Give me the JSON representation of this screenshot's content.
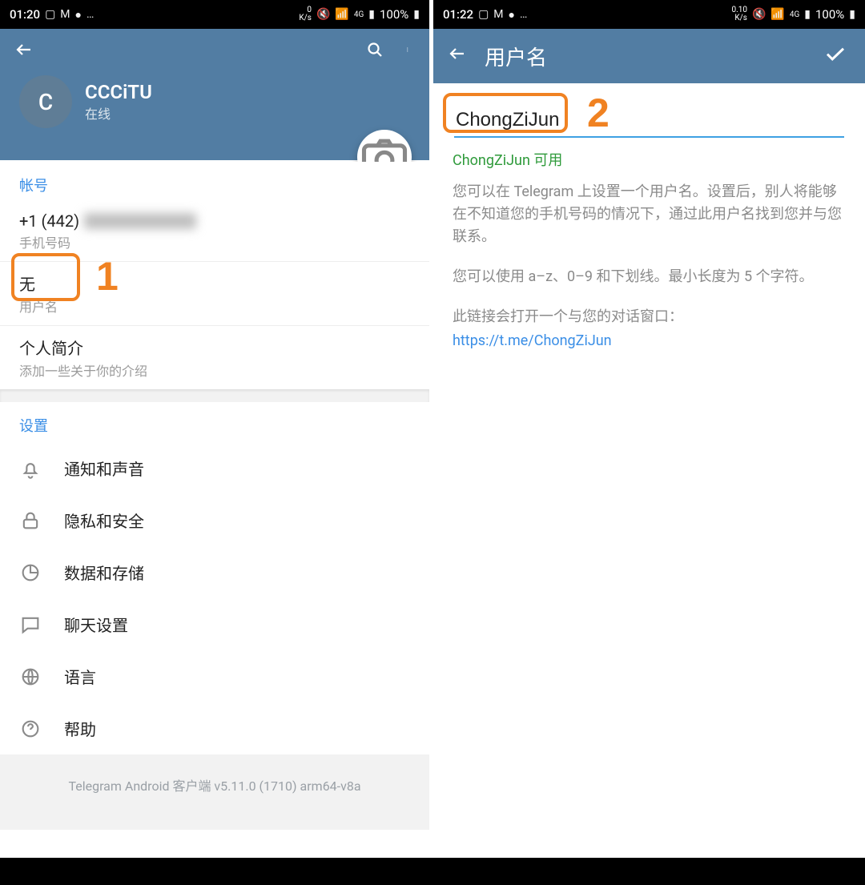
{
  "left": {
    "statusbar": {
      "time": "01:20",
      "kbs": "0\nK/s",
      "battery": "100%"
    },
    "profile": {
      "avatar_letter": "C",
      "name": "CCCiTU",
      "status": "在线"
    },
    "account_header": "帐号",
    "phone": {
      "value": "+1 (442)",
      "label": "手机号码"
    },
    "username": {
      "value": "无",
      "label": "用户名"
    },
    "bio": {
      "title": "个人简介",
      "sub": "添加一些关于你的介绍"
    },
    "settings_header": "设置",
    "settings": {
      "notify": "通知和声音",
      "privacy": "隐私和安全",
      "data": "数据和存储",
      "chat": "聊天设置",
      "lang": "语言",
      "help": "帮助"
    },
    "footer": "Telegram Android 客户端 v5.11.0 (1710) arm64-v8a",
    "annot": "1"
  },
  "right": {
    "statusbar": {
      "time": "01:22",
      "kbs": "0.10\nK/s",
      "battery": "100%"
    },
    "title": "用户名",
    "input_value": "ChongZiJun",
    "available": "ChongZiJun 可用",
    "desc1": "您可以在 Telegram 上设置一个用户名。设置后，别人将能够在不知道您的手机号码的情况下，通过此用户名找到您并与您联系。",
    "desc2": "您可以使用 a–z、0–9 和下划线。最小长度为 5 个字符。",
    "desc3": "此链接会打开一个与您的对话窗口：",
    "link": "https://t.me/ChongZiJun",
    "annot": "2"
  }
}
